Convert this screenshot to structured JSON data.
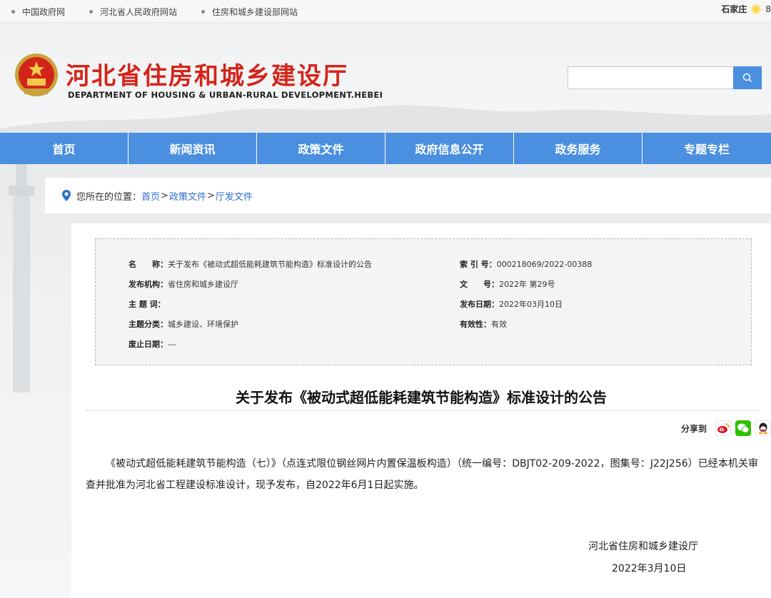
{
  "topbar": {
    "links": [
      "中国政府网",
      "河北省人民政府网站",
      "住房和城乡建设部网站"
    ],
    "weather_city": "石家庄",
    "weather_temp": "8"
  },
  "header": {
    "title": "河北省住房和城乡建设厅",
    "subtitle": "DEPARTMENT OF HOUSING & URBAN-RURAL DEVELOPMENT.HEBEI",
    "search_value": ""
  },
  "nav": [
    "首页",
    "新闻资讯",
    "政策文件",
    "政府信息公开",
    "政务服务",
    "专题专栏"
  ],
  "breadcrumb": {
    "label": "您所在的位置：",
    "items": [
      "首页",
      "政策文件",
      "厅发文件"
    ],
    "sep": ">"
  },
  "meta": {
    "name_key": "名　　称：",
    "name_val": "关于发布《被动式超低能耗建筑节能构造》标准设计的公告",
    "org_key": "发布机构：",
    "org_val": "省住房和城乡建设厅",
    "topic_key": "主 题 词：",
    "topic_val": "",
    "cat_key": "主题分类：",
    "cat_val": "城乡建设、环境保护",
    "abolish_key": "废止日期：",
    "abolish_val": "---",
    "index_key": "索 引 号：",
    "index_val": "000218069/2022-00388",
    "docno_key": "文　　号：",
    "docno_val": "2022年 第29号",
    "date_key": "发布日期：",
    "date_val": "2022年03月10日",
    "valid_key": "有效性：",
    "valid_val": "有效"
  },
  "article": {
    "title": "关于发布《被动式超低能耗建筑节能构造》标准设计的公告",
    "share_label": "分享到",
    "body": "《被动式超低能耗建筑节能构造（七）》（点连式限位钢丝网片内置保温板构造）（统一编号：DBJT02-209-2022，图集号：J22J256）已经本机关审查并批准为河北省工程建设标准设计，现予发布，自2022年6月1日起实施。",
    "sign_org": "河北省住房和城乡建设厅",
    "sign_date": "2022年3月10日"
  },
  "colors": {
    "nav_blue": "#4a8fe0",
    "title_red": "#d4241a",
    "link_blue": "#2f6fcc"
  }
}
